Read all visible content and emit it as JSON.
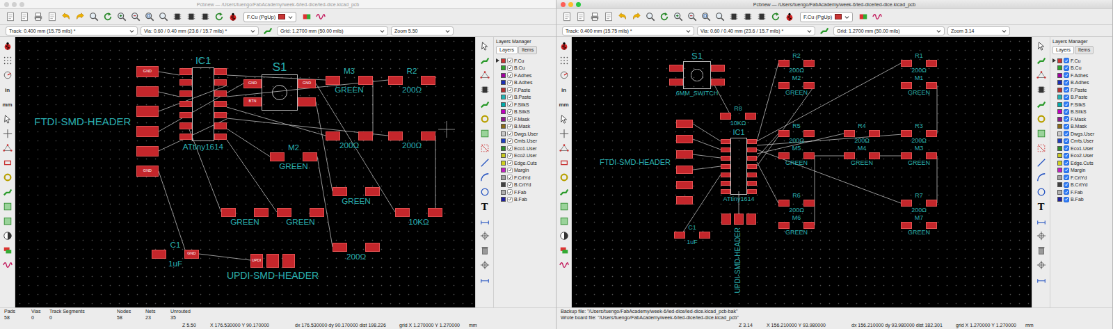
{
  "windows": [
    {
      "title": "Pcbnew — /Users/tuengo/FabAcademy/week-6/led-dice/led-dice.kicad_pcb",
      "active": false,
      "layer_select": "F.Cu (PgUp)",
      "options": {
        "track": "Track: 0.400 mm (15.75 mils) *",
        "via": "Via: 0.60 / 0.40 mm (23.6 / 15.7 mils) *",
        "grid": "Grid: 1.2700 mm (50.00 mils)",
        "zoom": "Zoom 5.50"
      },
      "toolbar_units": [
        "in",
        "mm"
      ],
      "text_tool": "T",
      "layers_manager": {
        "title": "Layers Manager",
        "tabs": [
          {
            "label": "Layers",
            "selected": true
          },
          {
            "label": "Items",
            "selected": false
          }
        ],
        "layers": [
          {
            "name": "F.Cu",
            "color": "#c83434",
            "visible": true,
            "active": true
          },
          {
            "name": "B.Cu",
            "color": "#2ea02e",
            "visible": true,
            "active": false
          },
          {
            "name": "F.Adhes",
            "color": "#a000a0",
            "visible": true,
            "active": false
          },
          {
            "name": "B.Adhes",
            "color": "#1c2fb6",
            "visible": true,
            "active": false
          },
          {
            "name": "F.Paste",
            "color": "#b43232",
            "visible": true,
            "active": false
          },
          {
            "name": "B.Paste",
            "color": "#20b2b2",
            "visible": true,
            "active": false
          },
          {
            "name": "F.SilkS",
            "color": "#00aaaa",
            "visible": true,
            "active": false
          },
          {
            "name": "B.SilkS",
            "color": "#c000c0",
            "visible": true,
            "active": false
          },
          {
            "name": "F.Mask",
            "color": "#8a1a8a",
            "visible": true,
            "active": false
          },
          {
            "name": "B.Mask",
            "color": "#8a6a1a",
            "visible": true,
            "active": false
          },
          {
            "name": "Dwgs.User",
            "color": "#c8c8c8",
            "visible": true,
            "active": false
          },
          {
            "name": "Cmts.User",
            "color": "#2040c0",
            "visible": true,
            "active": false
          },
          {
            "name": "Eco1.User",
            "color": "#2e8b2e",
            "visible": true,
            "active": false
          },
          {
            "name": "Eco2.User",
            "color": "#c8c820",
            "visible": true,
            "active": false
          },
          {
            "name": "Edge.Cuts",
            "color": "#d0d020",
            "visible": true,
            "active": false
          },
          {
            "name": "Margin",
            "color": "#c020c0",
            "visible": true,
            "active": false
          },
          {
            "name": "F.CrtYd",
            "color": "#a0a0a0",
            "visible": true,
            "active": false
          },
          {
            "name": "B.CrtYd",
            "color": "#404040",
            "visible": true,
            "active": false
          },
          {
            "name": "F.Fab",
            "color": "#b0b0b0",
            "visible": true,
            "active": false
          },
          {
            "name": "B.Fab",
            "color": "#2020a0",
            "visible": true,
            "active": false
          }
        ]
      },
      "board": {
        "footprints": [
          {
            "kind": "header",
            "ref": "FTDI-SMD-HEADER",
            "pads": [
              "GND",
              "GND"
            ]
          },
          {
            "kind": "chip",
            "ref": "IC1",
            "value": "ATtiny1614"
          },
          {
            "kind": "switch",
            "ref": "S1",
            "pads": [
              "GND",
              "GND",
              "BTN"
            ]
          },
          {
            "kind": "pair",
            "ref": "M3",
            "value": "GREEN"
          },
          {
            "kind": "pair",
            "ref": "R2",
            "value": "200Ω"
          },
          {
            "kind": "pair",
            "ref": "M2",
            "value": "GREEN"
          },
          {
            "kind": "pair",
            "value": "200Ω"
          },
          {
            "kind": "pair",
            "value": "200Ω"
          },
          {
            "kind": "pair",
            "value": "GREEN"
          },
          {
            "kind": "pair",
            "value": "GREEN"
          },
          {
            "kind": "pair",
            "value": "GREEN"
          },
          {
            "kind": "pair",
            "value": "200Ω"
          },
          {
            "kind": "pair",
            "value": "10KΩ"
          },
          {
            "kind": "pair",
            "ref": "C1",
            "value": "1uF",
            "pads": [
              "GND"
            ]
          },
          {
            "kind": "header-row",
            "ref": "UPDI-SMD-HEADER",
            "pads": [
              "UPDI"
            ]
          }
        ]
      },
      "stats": [
        {
          "label": "Pads",
          "value": "58"
        },
        {
          "label": "Vias",
          "value": "0"
        },
        {
          "label": "Track Segments",
          "value": "0"
        },
        {
          "label": "Nodes",
          "value": "58"
        },
        {
          "label": "Nets",
          "value": "23"
        },
        {
          "label": "Unrouted",
          "value": "35"
        }
      ],
      "messages": [],
      "status": {
        "zoom": "Z 5.50",
        "cursor": "X 176.530000 Y 90.170000",
        "delta": "dx 176.530000 dy 90.170000 dist 198.226",
        "grid": "grid X 1.270000 Y 1.270000",
        "units": "mm"
      }
    },
    {
      "title": "Pcbnew — /Users/tuengo/FabAcademy/week-6/led-dice/led-dice.kicad_pcb",
      "active": true,
      "layer_select": "F.Cu (PgUp)",
      "options": {
        "track": "Track: 0.400 mm (15.75 mils) *",
        "via": "Via: 0.60 / 0.40 mm (23.6 / 15.7 mils) *",
        "grid": "Grid: 1.2700 mm (50.00 mils)",
        "zoom": "Zoom 3.14"
      },
      "toolbar_units": [
        "in",
        "mm"
      ],
      "text_tool": "T",
      "layers_manager": {
        "title": "Layers Manager",
        "tabs": [
          {
            "label": "Layers",
            "selected": true
          },
          {
            "label": "Items",
            "selected": false
          }
        ],
        "layers": [
          {
            "name": "F.Cu",
            "color": "#c83434",
            "visible": true,
            "active": true
          },
          {
            "name": "B.Cu",
            "color": "#2ea02e",
            "visible": true,
            "active": false
          },
          {
            "name": "F.Adhes",
            "color": "#a000a0",
            "visible": true,
            "active": false
          },
          {
            "name": "B.Adhes",
            "color": "#1c2fb6",
            "visible": true,
            "active": false
          },
          {
            "name": "F.Paste",
            "color": "#b43232",
            "visible": true,
            "active": false
          },
          {
            "name": "B.Paste",
            "color": "#20b2b2",
            "visible": true,
            "active": false
          },
          {
            "name": "F.SilkS",
            "color": "#00aaaa",
            "visible": true,
            "active": false
          },
          {
            "name": "B.SilkS",
            "color": "#c000c0",
            "visible": true,
            "active": false
          },
          {
            "name": "F.Mask",
            "color": "#8a1a8a",
            "visible": true,
            "active": false
          },
          {
            "name": "B.Mask",
            "color": "#8a6a1a",
            "visible": true,
            "active": false
          },
          {
            "name": "Dwgs.User",
            "color": "#c8c8c8",
            "visible": true,
            "active": false
          },
          {
            "name": "Cmts.User",
            "color": "#2040c0",
            "visible": true,
            "active": false
          },
          {
            "name": "Eco1.User",
            "color": "#2e8b2e",
            "visible": true,
            "active": false
          },
          {
            "name": "Eco2.User",
            "color": "#c8c820",
            "visible": true,
            "active": false
          },
          {
            "name": "Edge.Cuts",
            "color": "#d0d020",
            "visible": true,
            "active": false
          },
          {
            "name": "Margin",
            "color": "#c020c0",
            "visible": true,
            "active": false
          },
          {
            "name": "F.CrtYd",
            "color": "#a0a0a0",
            "visible": true,
            "active": false
          },
          {
            "name": "B.CrtYd",
            "color": "#404040",
            "visible": true,
            "active": false
          },
          {
            "name": "F.Fab",
            "color": "#b0b0b0",
            "visible": true,
            "active": false
          },
          {
            "name": "B.Fab",
            "color": "#2020a0",
            "visible": true,
            "active": false
          }
        ]
      },
      "board": {
        "footprints": [
          {
            "kind": "switch",
            "ref": "S1",
            "value": "6MM_SWITCH"
          },
          {
            "kind": "pair",
            "ref": "R2",
            "value": "200Ω"
          },
          {
            "kind": "pair",
            "ref": "M2",
            "value": "GREEN"
          },
          {
            "kind": "pair",
            "ref": "R1",
            "value": "200Ω"
          },
          {
            "kind": "pair",
            "ref": "M1",
            "value": "GREEN"
          },
          {
            "kind": "pair",
            "ref": "R8",
            "value": "10KΩ"
          },
          {
            "kind": "pair",
            "ref": "R5",
            "value": "200Ω"
          },
          {
            "kind": "pair",
            "ref": "M5",
            "value": "GREEN"
          },
          {
            "kind": "pair",
            "ref": "R4",
            "value": "200Ω"
          },
          {
            "kind": "pair",
            "ref": "M4",
            "value": "GREEN"
          },
          {
            "kind": "pair",
            "ref": "R3",
            "value": "200Ω"
          },
          {
            "kind": "pair",
            "ref": "M3",
            "value": "GREEN"
          },
          {
            "kind": "header",
            "ref": "FTDI-SMD-HEADER"
          },
          {
            "kind": "chip",
            "ref": "IC1",
            "value": "ATtiny1614"
          },
          {
            "kind": "pair",
            "ref": "R6",
            "value": "200Ω"
          },
          {
            "kind": "pair",
            "ref": "M6",
            "value": "GREEN"
          },
          {
            "kind": "pair",
            "ref": "R7",
            "value": "200Ω"
          },
          {
            "kind": "pair",
            "ref": "M7",
            "value": "GREEN"
          },
          {
            "kind": "pair",
            "ref": "C1",
            "value": "1uF"
          },
          {
            "kind": "header-row",
            "ref": "UPDI-SMD-HEADER"
          }
        ]
      },
      "stats": [],
      "messages": [
        "Backup file: \"/Users/tuengo/FabAcademy/week-6/led-dice/led-dice.kicad_pcb-bak\"",
        "Wrote board file: \"/Users/tuengo/FabAcademy/week-6/led-dice/led-dice.kicad_pcb\""
      ],
      "status": {
        "zoom": "Z 3.14",
        "cursor": "X 156.210000 Y 93.980000",
        "delta": "dx 156.210000 dy 93.980000 dist 182.301",
        "grid": "grid X 1.270000 Y 1.270000",
        "units": "mm"
      }
    }
  ]
}
